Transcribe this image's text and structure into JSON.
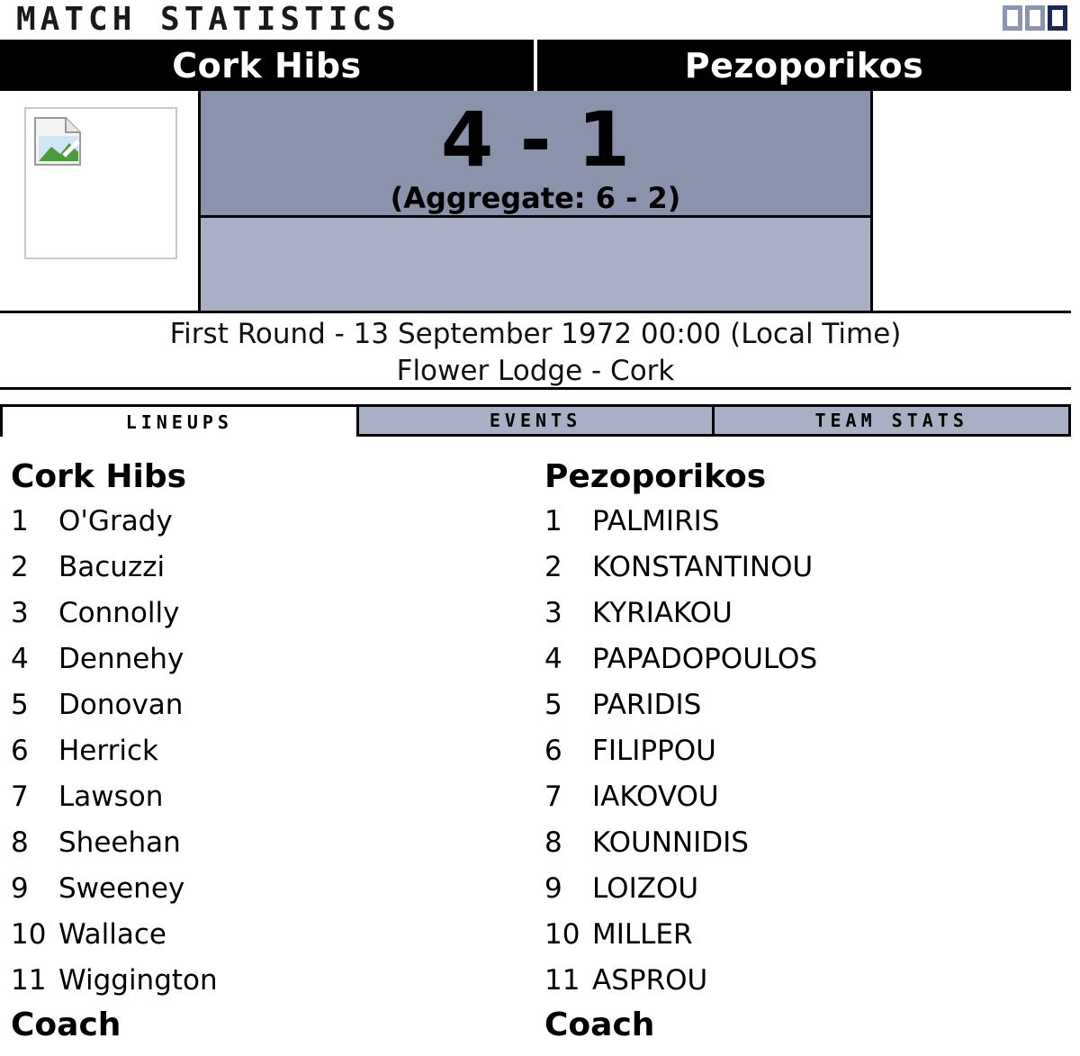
{
  "header": {
    "title": "MATCH STATISTICS"
  },
  "window_buttons": [
    "minimize-box",
    "restore-box",
    "active-box"
  ],
  "teams": {
    "home": "Cork Hibs",
    "away": "Pezoporikos"
  },
  "score": {
    "result": "4 - 1",
    "aggregate": "(Aggregate: 6 - 2)"
  },
  "match_info": {
    "round_date": "First Round - 13 September 1972 00:00 (Local Time)",
    "venue": "Flower Lodge - Cork"
  },
  "tabs": [
    {
      "label": "LINEUPS",
      "active": true
    },
    {
      "label": "EVENTS",
      "active": false
    },
    {
      "label": "TEAM STATS",
      "active": false
    }
  ],
  "lineups": {
    "home": {
      "team": "Cork Hibs",
      "players": [
        {
          "num": "1",
          "name": "O'Grady"
        },
        {
          "num": "2",
          "name": "Bacuzzi"
        },
        {
          "num": "3",
          "name": "Connolly"
        },
        {
          "num": "4",
          "name": "Dennehy"
        },
        {
          "num": "5",
          "name": "Donovan"
        },
        {
          "num": "6",
          "name": "Herrick"
        },
        {
          "num": "7",
          "name": "Lawson"
        },
        {
          "num": "8",
          "name": "Sheehan"
        },
        {
          "num": "9",
          "name": "Sweeney"
        },
        {
          "num": "10",
          "name": "Wallace"
        },
        {
          "num": "11",
          "name": "Wiggington"
        }
      ],
      "coach_label": "Coach"
    },
    "away": {
      "team": "Pezoporikos",
      "players": [
        {
          "num": "1",
          "name": "PALMIRIS"
        },
        {
          "num": "2",
          "name": "KONSTANTINOU"
        },
        {
          "num": "3",
          "name": "KYRIAKOU"
        },
        {
          "num": "4",
          "name": "PAPADOPOULOS"
        },
        {
          "num": "5",
          "name": "PARIDIS"
        },
        {
          "num": "6",
          "name": "FILIPPOU"
        },
        {
          "num": "7",
          "name": "IAKOVOU"
        },
        {
          "num": "8",
          "name": "KOUNNIDIS"
        },
        {
          "num": "9",
          "name": "LOIZOU"
        },
        {
          "num": "10",
          "name": "MILLER"
        },
        {
          "num": "11",
          "name": "ASPROU"
        }
      ],
      "coach_label": "Coach"
    }
  },
  "colors": {
    "score_top": "#8a93ab",
    "score_bottom": "#a9b0c5",
    "tab_inactive": "#a9b0c5",
    "header_bg": "#000000"
  }
}
